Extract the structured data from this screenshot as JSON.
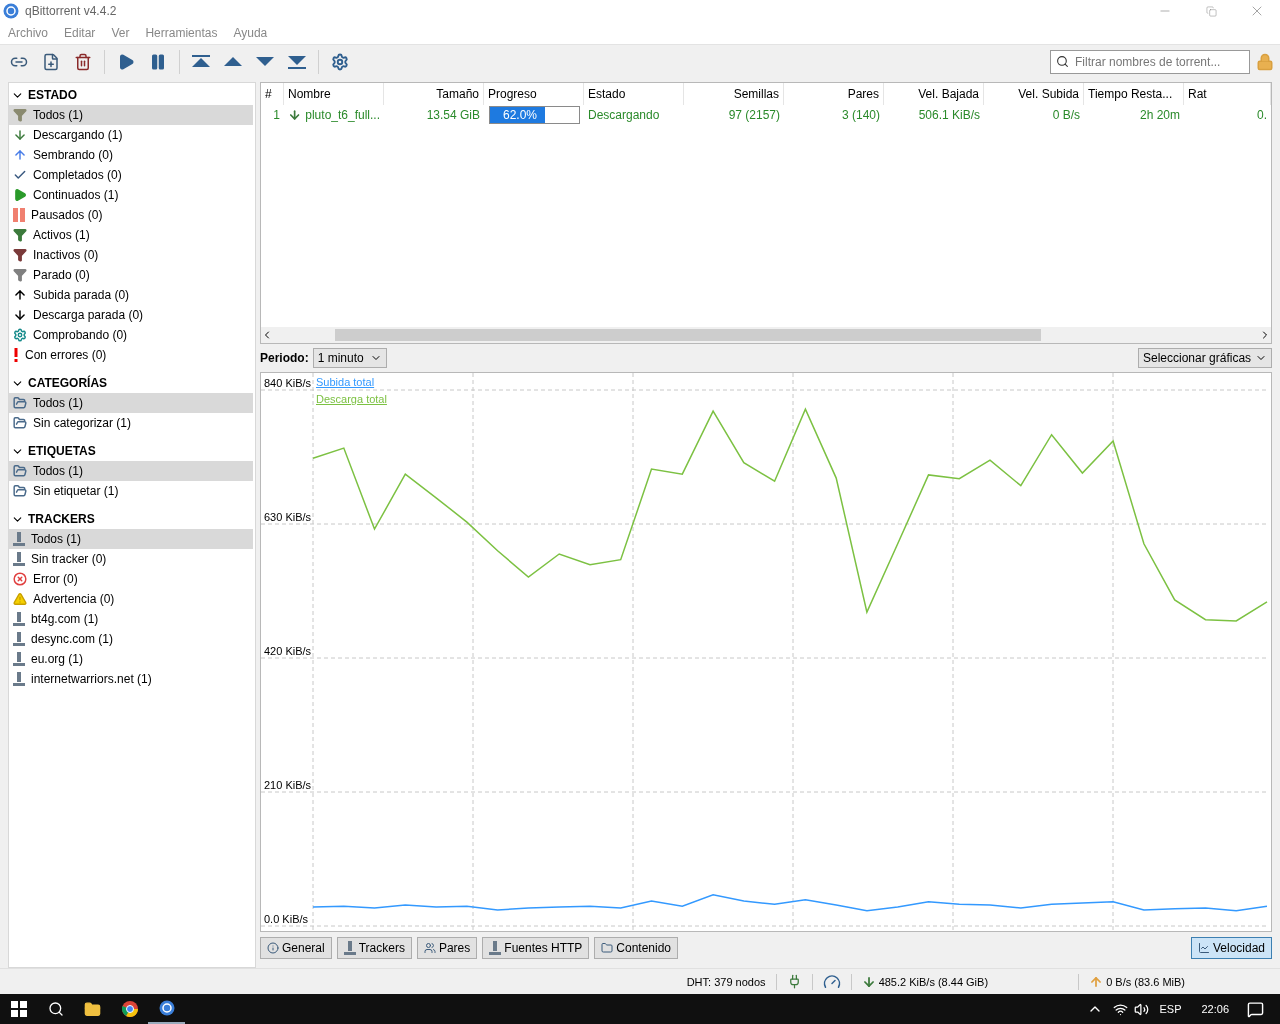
{
  "window": {
    "title": "qBittorrent v4.4.2"
  },
  "menu": [
    "Archivo",
    "Editar",
    "Ver",
    "Herramientas",
    "Ayuda"
  ],
  "search": {
    "placeholder": "Filtrar nombres de torrent..."
  },
  "sidebar": [
    {
      "title": "ESTADO",
      "expanded": true,
      "items": [
        {
          "label": "Todos (1)",
          "selected": true
        },
        {
          "label": "Descargando (1)",
          "selected": false
        },
        {
          "label": "Sembrando (0)",
          "selected": false
        },
        {
          "label": "Completados (0)",
          "selected": false
        },
        {
          "label": "Continuados (1)",
          "selected": false
        },
        {
          "label": "Pausados (0)",
          "selected": false
        },
        {
          "label": "Activos (1)",
          "selected": false
        },
        {
          "label": "Inactivos (0)",
          "selected": false
        },
        {
          "label": "Parado (0)",
          "selected": false
        },
        {
          "label": "Subida parada (0)",
          "selected": false
        },
        {
          "label": "Descarga parada (0)",
          "selected": false
        },
        {
          "label": "Comprobando (0)",
          "selected": false
        },
        {
          "label": "Con errores (0)",
          "selected": false
        }
      ]
    },
    {
      "title": "CATEGORÍAS",
      "expanded": true,
      "items": [
        {
          "label": "Todos (1)",
          "selected": true
        },
        {
          "label": "Sin categorizar (1)",
          "selected": false
        }
      ]
    },
    {
      "title": "ETIQUETAS",
      "expanded": true,
      "items": [
        {
          "label": "Todos (1)",
          "selected": true
        },
        {
          "label": "Sin etiquetar (1)",
          "selected": false
        }
      ]
    },
    {
      "title": "TRACKERS",
      "expanded": true,
      "items": [
        {
          "label": "Todos (1)",
          "selected": true
        },
        {
          "label": "Sin tracker (0)",
          "selected": false
        },
        {
          "label": "Error (0)",
          "selected": false
        },
        {
          "label": "Advertencia (0)",
          "selected": false
        },
        {
          "label": "bt4g.com (1)",
          "selected": false
        },
        {
          "label": "desync.com (1)",
          "selected": false
        },
        {
          "label": "eu.org (1)",
          "selected": false
        },
        {
          "label": "internetwarriors.net (1)",
          "selected": false
        }
      ]
    }
  ],
  "table": {
    "columns": [
      "#",
      "Nombre",
      "Tamaño",
      "Progreso",
      "Estado",
      "Semillas",
      "Pares",
      "Vel. Bajada",
      "Vel. Subida",
      "Tiempo Resta...",
      "Rat"
    ],
    "rows": [
      {
        "index": "1",
        "name": "pluto_t6_full...",
        "size": "13.54 GiB",
        "progress": {
          "level": 0.62,
          "text": "62.0%"
        },
        "status": "Descargando",
        "seeds": "97 (2157)",
        "peers": "3 (140)",
        "down": "506.1 KiB/s",
        "up": "0 B/s",
        "eta": "2h 20m",
        "ratio": "0."
      }
    ]
  },
  "graph": {
    "period_label": "Periodo:",
    "period": "1 minuto",
    "select": "Seleccionar gráficas",
    "chart_data": {
      "type": "line",
      "grid": true,
      "ylim": [
        0,
        840
      ],
      "yticks": [
        {
          "value": 0,
          "label": "0.0 KiB/s"
        },
        {
          "value": 210,
          "label": "210 KiB/s"
        },
        {
          "value": 420,
          "label": "420 KiB/s"
        },
        {
          "value": 630,
          "label": "630 KiB/s"
        },
        {
          "value": 840,
          "label": "840 KiB/s"
        }
      ],
      "series": [
        {
          "name": "Subida total",
          "color": "#3399ff",
          "values": [
            30,
            31,
            28,
            33,
            30,
            31,
            25,
            28,
            30,
            31,
            28,
            39,
            31,
            49,
            39,
            34,
            41,
            33,
            24,
            30,
            38,
            34,
            33,
            28,
            34,
            36,
            38,
            25,
            27,
            28,
            24,
            31
          ]
        },
        {
          "name": "Descarga total",
          "color": "#7cc142",
          "values": [
            733,
            749,
            622,
            708,
            671,
            633,
            588,
            547,
            583,
            566,
            574,
            716,
            708,
            807,
            726,
            697,
            810,
            702,
            492,
            599,
            707,
            701,
            730,
            690,
            770,
            710,
            760,
            599,
            511,
            480,
            478,
            508
          ]
        }
      ]
    }
  },
  "tabs": [
    {
      "label": "General",
      "selected": false
    },
    {
      "label": "Trackers",
      "selected": false
    },
    {
      "label": "Pares",
      "selected": false
    },
    {
      "label": "Fuentes HTTP",
      "selected": false
    },
    {
      "label": "Contenido",
      "selected": false
    },
    {
      "label": "Velocidad",
      "selected": true
    }
  ],
  "status_bar": {
    "dht": "DHT: 379 nodos",
    "download": "485.2 KiB/s (8.44 GiB)",
    "upload": "0 B/s (83.6 MiB)"
  },
  "taskbar": {
    "language": "ESP",
    "time": "22:06"
  }
}
